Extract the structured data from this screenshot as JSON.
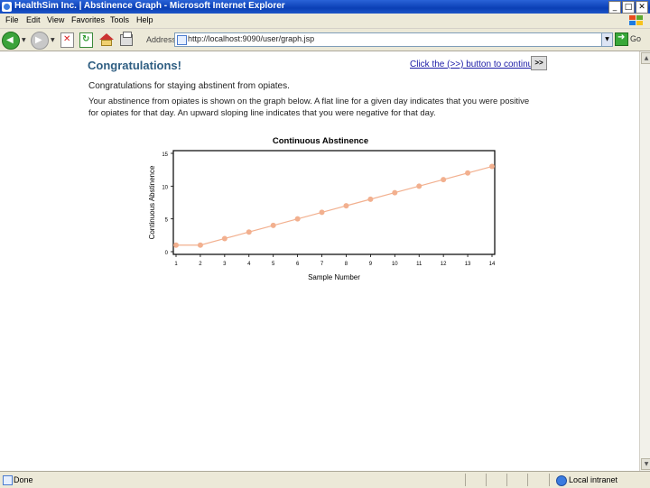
{
  "window": {
    "title": "HealthSim Inc. | Abstinence Graph - Microsoft Internet Explorer"
  },
  "menu": {
    "items": [
      "File",
      "Edit",
      "View",
      "Favorites",
      "Tools",
      "Help"
    ]
  },
  "toolbar": {
    "address_label": "Address",
    "url": "http://localhost:9090/user/graph.jsp",
    "go_label": "Go"
  },
  "page": {
    "heading": "Congratulations!",
    "continue_link": "Click the (>>) button to continue",
    "continue_button": ">>",
    "line1": "Congratulations for staying abstinent from opiates.",
    "line2": "Your abstinence from opiates is shown on the graph below.  A flat line for a given day indicates that you were positive for opiates for that day.  An upward sloping line indicates that you were negative for that day."
  },
  "chart_data": {
    "type": "line",
    "title": "Continuous Abstinence",
    "xlabel": "Sample Number",
    "ylabel": "Continuous Abstinence",
    "x": [
      1,
      2,
      3,
      4,
      5,
      6,
      7,
      8,
      9,
      10,
      11,
      12,
      13,
      14
    ],
    "y": [
      1,
      1,
      2,
      3,
      4,
      5,
      6,
      7,
      8,
      9,
      10,
      11,
      12,
      13
    ],
    "xlim": [
      1,
      14
    ],
    "ylim": [
      0,
      15
    ],
    "yticks": [
      0,
      5,
      10,
      15
    ],
    "grid": false,
    "color": "#f2b08f"
  },
  "status": {
    "text": "Done",
    "zone": "Local intranet"
  }
}
